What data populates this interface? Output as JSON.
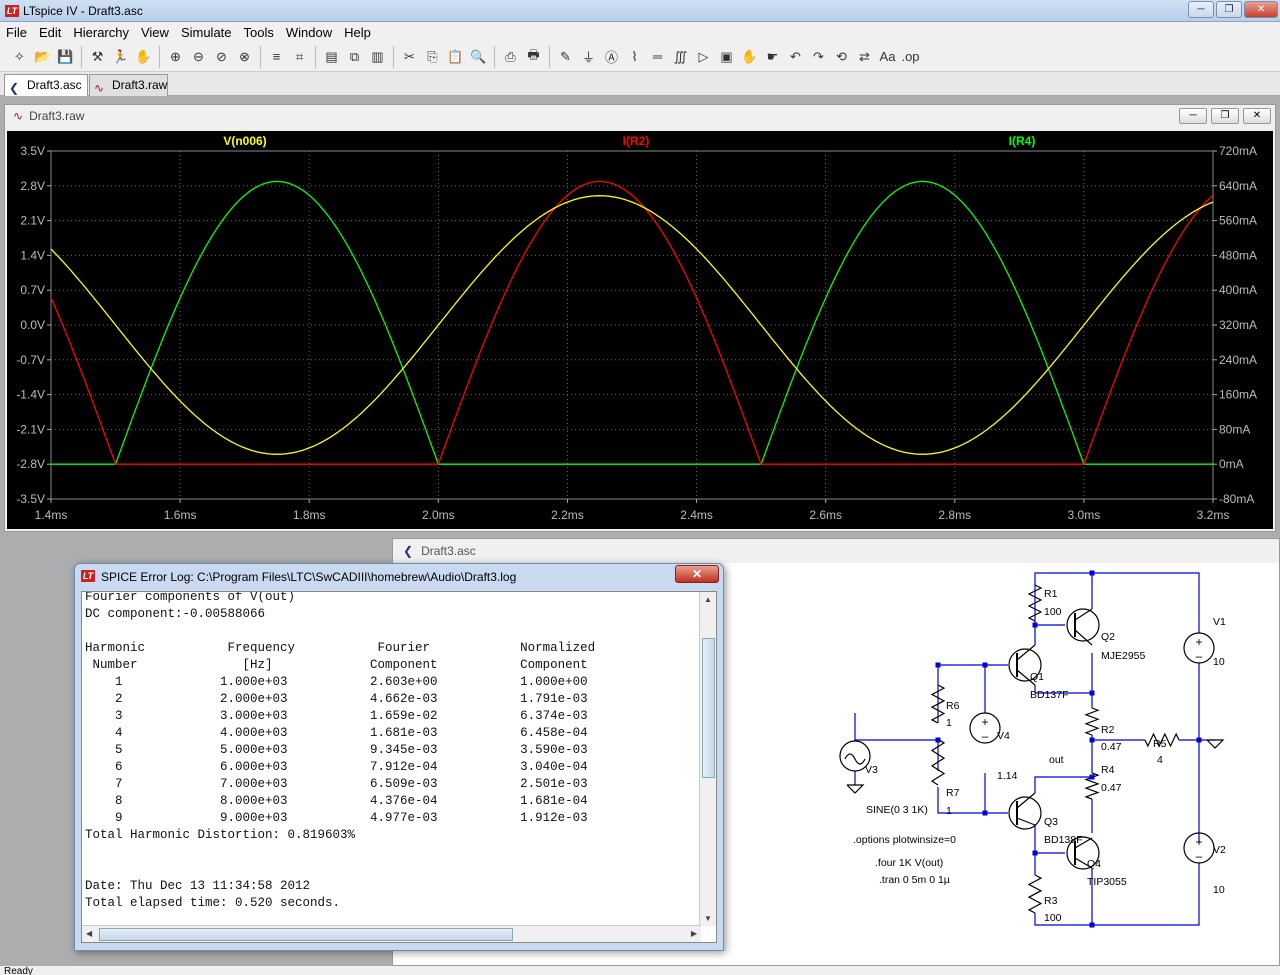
{
  "window": {
    "title": "LTspice IV - Draft3.asc",
    "logo": "LT"
  },
  "menu": [
    "File",
    "Edit",
    "Hierarchy",
    "View",
    "Simulate",
    "Tools",
    "Window",
    "Help"
  ],
  "toolbar_icons": [
    "new-schematic-icon",
    "open-icon",
    "save-icon",
    "control-panel-icon",
    "run-icon",
    "halt-icon",
    "zoom-in-icon",
    "zoom-out-icon",
    "zoom-fit-icon",
    "zoom-cancel-icon",
    "autorange-icon",
    "grid-icon",
    "tile-horizontal-icon",
    "cascade-icon",
    "tile-vertical-icon",
    "cut-icon",
    "copy-icon",
    "paste-icon",
    "find-icon",
    "print-setup-icon",
    "print-icon",
    "draw-wire-icon",
    "ground-icon",
    "label-net-icon",
    "resistor-icon",
    "capacitor-icon",
    "inductor-icon",
    "diode-icon",
    "component-icon",
    "move-icon",
    "drag-icon",
    "undo-icon",
    "redo-icon",
    "rotate-icon",
    "mirror-icon",
    "text-icon",
    "spice-directive-icon"
  ],
  "tabs": [
    {
      "label": "Draft3.asc"
    },
    {
      "label": "Draft3.raw"
    }
  ],
  "plot_window": {
    "title": "Draft3.raw"
  },
  "schematic_window": {
    "title": "Draft3.asc"
  },
  "chart_data": {
    "type": "line",
    "series": [
      {
        "name": "V(n006)",
        "color": "#ffff00",
        "axis": "left"
      },
      {
        "name": "I(R2)",
        "color": "#ff0000",
        "axis": "right"
      },
      {
        "name": "I(R4)",
        "color": "#00ff00",
        "axis": "right"
      }
    ],
    "x_ticks": [
      "1.4ms",
      "1.6ms",
      "1.8ms",
      "2.0ms",
      "2.2ms",
      "2.4ms",
      "2.6ms",
      "2.8ms",
      "3.0ms",
      "3.2ms"
    ],
    "y_left_ticks": [
      "3.5V",
      "2.8V",
      "2.1V",
      "1.4V",
      "0.7V",
      "0.0V",
      "-0.7V",
      "-1.4V",
      "-2.1V",
      "-2.8V",
      "-3.5V"
    ],
    "y_right_ticks": [
      "720mA",
      "640mA",
      "560mA",
      "480mA",
      "400mA",
      "320mA",
      "240mA",
      "160mA",
      "80mA",
      "0mA",
      "-80mA"
    ],
    "xlim": [
      1.4,
      3.2
    ],
    "ylim_left": [
      -3.5,
      3.5
    ],
    "ylim_right": [
      -80,
      720
    ],
    "v_amplitude": 2.6,
    "v_frequency_hz": 1000,
    "i_peak_mA": 650
  },
  "log_window": {
    "title": "SPICE Error Log: C:\\Program Files\\LTC\\SwCADIII\\homebrew\\Audio\\Draft3.log",
    "lines": [
      "Fourier components of V(out)",
      "DC component:-0.00588066",
      "",
      "Harmonic           Frequency           Fourier            Normalized",
      " Number              [Hz]             Component           Component",
      "    1             1.000e+03           2.603e+00           1.000e+00",
      "    2             2.000e+03           4.662e-03           1.791e-03",
      "    3             3.000e+03           1.659e-02           6.374e-03",
      "    4             4.000e+03           1.681e-03           6.458e-04",
      "    5             5.000e+03           9.345e-03           3.590e-03",
      "    6             6.000e+03           7.912e-04           3.040e-04",
      "    7             7.000e+03           6.509e-03           2.501e-03",
      "    8             8.000e+03           4.376e-04           1.681e-04",
      "    9             9.000e+03           4.977e-03           1.912e-03",
      "Total Harmonic Distortion: 0.819603%",
      "",
      "",
      "Date: Thu Dec 13 11:34:58 2012",
      "Total elapsed time: 0.520 seconds."
    ]
  },
  "schematic": {
    "components": [
      {
        "ref": "R1",
        "value": "100"
      },
      {
        "ref": "R2",
        "value": "0.47"
      },
      {
        "ref": "R3",
        "value": "100"
      },
      {
        "ref": "R4",
        "value": "0.47"
      },
      {
        "ref": "R5",
        "value": "4"
      },
      {
        "ref": "R6",
        "value": "1"
      },
      {
        "ref": "R7",
        "value": "1"
      },
      {
        "ref": "Q1",
        "value": "BD137F"
      },
      {
        "ref": "Q2",
        "value": "MJE2955"
      },
      {
        "ref": "Q3",
        "value": "BD138F"
      },
      {
        "ref": "Q4",
        "value": "TIP3055"
      },
      {
        "ref": "V1",
        "value": "10"
      },
      {
        "ref": "V2",
        "value": "10"
      },
      {
        "ref": "V3",
        "value": "SINE(0 3 1K)"
      },
      {
        "ref": "V4",
        "value": "1.14"
      }
    ],
    "net_label": "out",
    "directives": [
      ".options plotwinsize=0",
      ".four 1K V(out)",
      ".tran 0 5m 0 1µ"
    ]
  },
  "status": {
    "text": "Ready"
  }
}
